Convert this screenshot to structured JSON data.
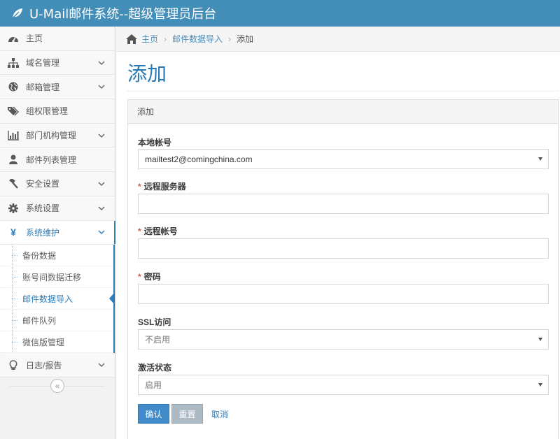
{
  "app": {
    "title": "U-Mail邮件系统--超级管理员后台"
  },
  "sidebar": {
    "items": [
      {
        "label": "主页",
        "icon": "dashboard-icon"
      },
      {
        "label": "域名管理",
        "icon": "sitemap-icon"
      },
      {
        "label": "邮箱管理",
        "icon": "globe-icon"
      },
      {
        "label": "组权限管理",
        "icon": "tags-icon"
      },
      {
        "label": "部门机构管理",
        "icon": "bar-chart-icon"
      },
      {
        "label": "邮件列表管理",
        "icon": "user-icon"
      },
      {
        "label": "安全设置",
        "icon": "gavel-icon"
      },
      {
        "label": "系统设置",
        "icon": "cog-icon"
      },
      {
        "label": "系统维护",
        "icon": "yen-icon"
      },
      {
        "label": "日志/报告",
        "icon": "lightbulb-icon"
      }
    ],
    "submenu": [
      {
        "label": "备份数据"
      },
      {
        "label": "账号间数据迁移"
      },
      {
        "label": "邮件数据导入"
      },
      {
        "label": "邮件队列"
      },
      {
        "label": "微信版管理"
      }
    ],
    "collapse_glyph": "«"
  },
  "breadcrumb": {
    "home": "主页",
    "section": "邮件数据导入",
    "current": "添加",
    "separator": "›"
  },
  "page": {
    "title": "添加"
  },
  "panel": {
    "heading": "添加"
  },
  "form": {
    "local_account": {
      "label": "本地帐号",
      "value": "mailtest2@comingchina.com"
    },
    "remote_server": {
      "label": "远程服务器",
      "value": ""
    },
    "remote_account": {
      "label": "远程帐号",
      "value": ""
    },
    "password": {
      "label": "密码",
      "value": ""
    },
    "ssl": {
      "label": "SSL访问",
      "value": "不启用"
    },
    "activation": {
      "label": "激活状态",
      "value": "启用"
    },
    "required_mark": "*"
  },
  "buttons": {
    "confirm": "确认",
    "reset": "重置",
    "cancel": "取消"
  },
  "colors": {
    "header": "#438eb9",
    "accent": "#2b7dbc",
    "primary_button": "#428bca",
    "reset_button": "#abbac3",
    "required": "#d15b47"
  }
}
